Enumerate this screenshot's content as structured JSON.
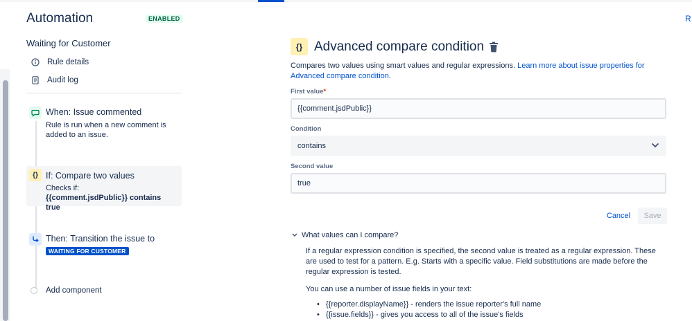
{
  "header": {
    "app_title": "Automation",
    "status_badge": "ENABLED",
    "right_cut_text": "R"
  },
  "sidebar": {
    "rule_name": "Waiting for Customer",
    "nav": [
      {
        "label": "Rule details",
        "icon": "info-icon"
      },
      {
        "label": "Audit log",
        "icon": "document-icon"
      }
    ],
    "steps": {
      "when": {
        "title": "When: Issue commented",
        "desc": "Rule is run when a new comment is added to an issue.",
        "icon": "comment-icon"
      },
      "if": {
        "title": "If: Compare two values",
        "desc_prefix": "Checks if:",
        "desc_expr": "{{comment.jsdPublic}} contains true",
        "icon_glyph": "{}"
      },
      "then": {
        "title": "Then: Transition the issue to",
        "status": "WAITING FOR CUSTOMER",
        "icon": "transition-icon"
      }
    },
    "add_component": "Add component"
  },
  "main": {
    "icon_glyph": "{}",
    "title": "Advanced compare condition",
    "description": "Compares two values using smart values and regular expressions.",
    "description_link": "Learn more about issue properties for Advanced compare condition",
    "description_end": ".",
    "first_value_label": "First value",
    "required_mark": "*",
    "first_value": "{{comment.jsdPublic}}",
    "condition_label": "Condition",
    "condition_value": "contains",
    "second_value_label": "Second value",
    "second_value": "true",
    "cancel_label": "Cancel",
    "save_label": "Save",
    "help_toggle": "What values can I compare?",
    "help_p1": "If a regular expression condition is specified, the second value is treated as a regular expression. These are used to test for a pattern. E.g. Starts with a specific value. Field substitutions are made before the regular expression is tested.",
    "help_p2": "You can use a number of issue fields in your text:",
    "help_bullets": [
      "{{reporter.displayName}} - renders the issue reporter's full name",
      "{{issue.fields}} - gives you access to all of the issue's fields"
    ]
  },
  "colors": {
    "accent": "#0052cc",
    "enabled_green": "#006644",
    "condition_yellow": "#fff0b3",
    "text": "#172b4d"
  }
}
